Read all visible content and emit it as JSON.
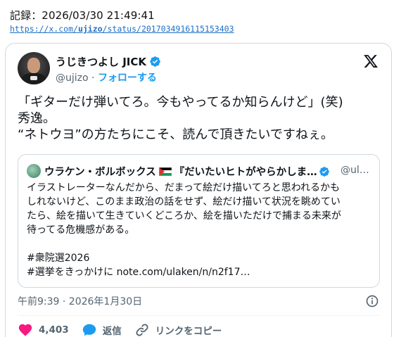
{
  "record": {
    "label": "記録：2026/03/30 21:49:41",
    "url_prefix": "https://x.com/",
    "url_user": "ujizo",
    "url_suffix": "/status/2017034916115153403"
  },
  "post": {
    "author_name": "うじきつよし JICK",
    "handle": "@ujizo",
    "separator": "·",
    "follow_label": "フォローする",
    "text_lines": [
      "「ギターだけ弾いてろ。今もやってるか知らんけど」(笑)",
      "秀逸。",
      "“ネトウヨ”の方たちにこそ、読んで頂きたいですねぇ。"
    ],
    "timestamp": "午前9:39 · 2026年1月30日",
    "verified_color": "#1d9bf0"
  },
  "quote": {
    "author_name_part1": "ウラケン・ボルボックス",
    "author_name_part2": "『だいたいヒトがやらかしま…",
    "handle": "@ul…",
    "text_lines": [
      "イラストレーターなんだから、だまって絵だけ描いてろと思われるかも",
      "しれないけど、このまま政治の話をせず、絵だけ描いて状況を眺めてい",
      "たら、絵を描いて生きていくどころか、絵を描いただけで捕まる未来が",
      "待ってる危機感がある。",
      "",
      "#衆院選2026",
      "#選挙をきっかけに note.com/ulaken/n/n2f17…"
    ]
  },
  "actions": {
    "like_count": "4,403",
    "reply_label": "返信",
    "copy_link_label": "リンクをコピー",
    "like_color": "#f91880",
    "reply_color": "#1d9bf0"
  },
  "icons": {
    "x_logo": "x-logo-icon",
    "verified": "verified-badge-icon",
    "info": "info-icon",
    "like": "heart-icon",
    "reply": "speech-bubble-icon",
    "link": "link-icon",
    "flag": "palestine-flag-icon"
  }
}
